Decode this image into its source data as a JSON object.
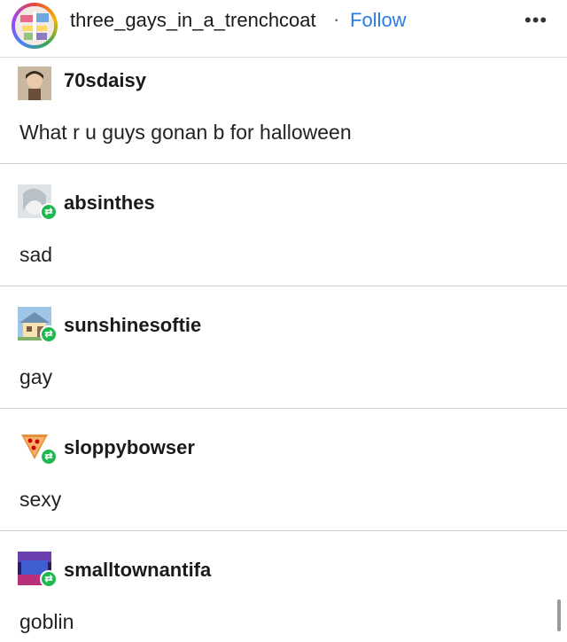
{
  "header": {
    "username": "three_gays_in_a_trenchcoat",
    "separator": "·",
    "follow_label": "Follow",
    "more_label": "•••"
  },
  "replies": [
    {
      "username": "70sdaisy",
      "text": "What r u guys gonan b for halloween",
      "reblog_badge": false
    },
    {
      "username": "absinthes",
      "text": "sad",
      "reblog_badge": true
    },
    {
      "username": "sunshinesoftie",
      "text": "gay",
      "reblog_badge": true
    },
    {
      "username": "sloppybowser",
      "text": "sexy",
      "reblog_badge": true
    },
    {
      "username": "smalltownantifa",
      "text": "goblin",
      "reblog_badge": true
    }
  ],
  "badge_glyph": "⇄",
  "colors": {
    "follow": "#2c7be5",
    "reblog_badge": "#1fb84f"
  }
}
